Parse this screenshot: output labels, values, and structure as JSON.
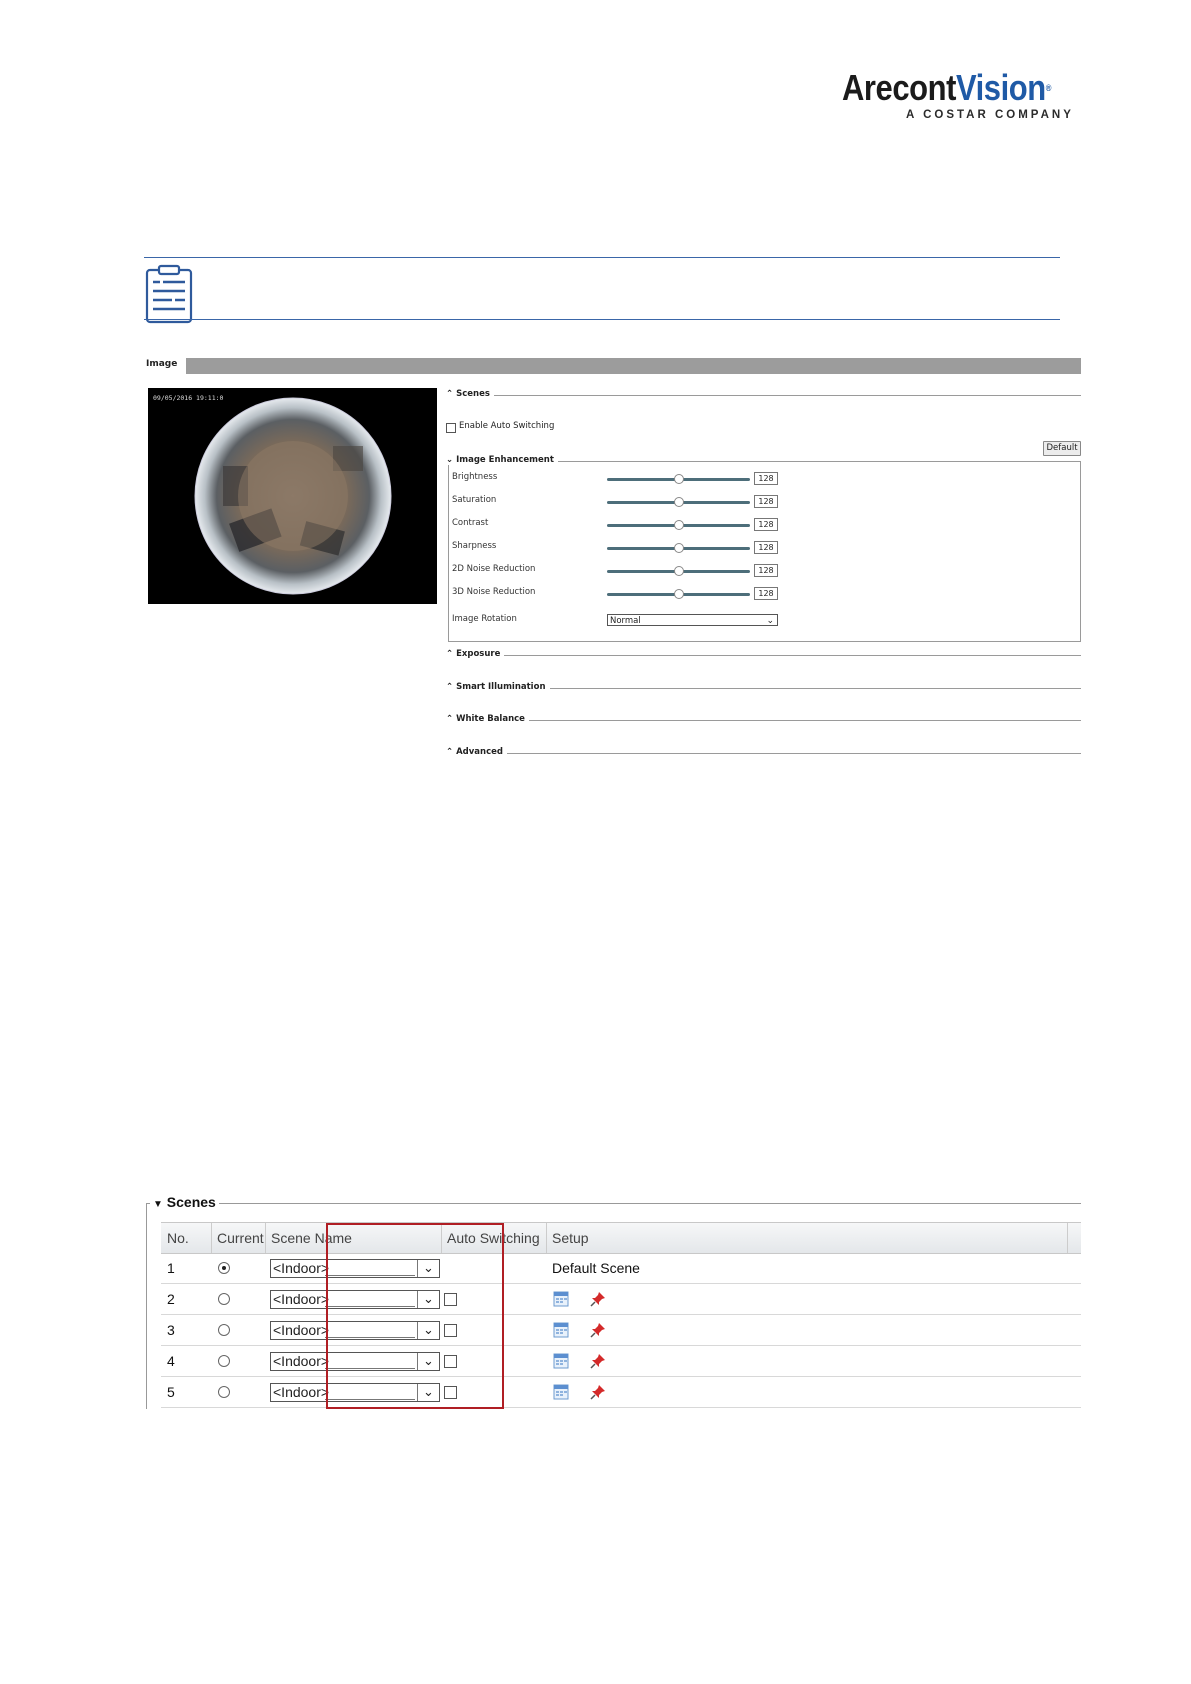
{
  "brand": {
    "name_part1": "Arecont",
    "name_part2": "Vision",
    "registered": "®",
    "subtitle": "A COSTAR COMPANY",
    "colors": {
      "dark": "#1b1b1b",
      "blue": "#1f5aa6"
    }
  },
  "note": {
    "icon": "clipboard-note-icon",
    "accent": "#3a66a8"
  },
  "image_panel": {
    "title": "Image",
    "camera_timestamp": "09/05/2016 19:11:0",
    "scenes_label": "Scenes",
    "enable_auto_switching_label": "Enable Auto Switching",
    "default_button": "Default",
    "image_enhancement_label": "Image Enhancement",
    "sliders": [
      {
        "label": "Brightness",
        "value": "128",
        "level": 0.5
      },
      {
        "label": "Saturation",
        "value": "128",
        "level": 0.5
      },
      {
        "label": "Contrast",
        "value": "128",
        "level": 0.5
      },
      {
        "label": "Sharpness",
        "value": "128",
        "level": 0.5
      },
      {
        "label": "2D Noise Reduction",
        "value": "128",
        "level": 0.5
      },
      {
        "label": "3D Noise Reduction",
        "value": "128",
        "level": 0.5
      }
    ],
    "rotation_label": "Image Rotation",
    "rotation_value": "Normal",
    "collapsed_sections": [
      "Exposure",
      "Smart Illumination",
      "White Balance",
      "Advanced"
    ]
  },
  "scenes_table": {
    "title": "Scenes",
    "headers": [
      "No.",
      "Current",
      "Scene Name",
      "Auto Switching",
      "Setup"
    ],
    "rows": [
      {
        "no": "1",
        "current": true,
        "scene": "<Indoor>",
        "auto": null,
        "setup_text": "Default Scene"
      },
      {
        "no": "2",
        "current": false,
        "scene": "<Indoor>",
        "auto": false,
        "setup_text": ""
      },
      {
        "no": "3",
        "current": false,
        "scene": "<Indoor>",
        "auto": false,
        "setup_text": ""
      },
      {
        "no": "4",
        "current": false,
        "scene": "<Indoor>",
        "auto": false,
        "setup_text": ""
      },
      {
        "no": "5",
        "current": false,
        "scene": "<Indoor>",
        "auto": false,
        "setup_text": ""
      }
    ],
    "highlight_color": "#b01e24"
  }
}
